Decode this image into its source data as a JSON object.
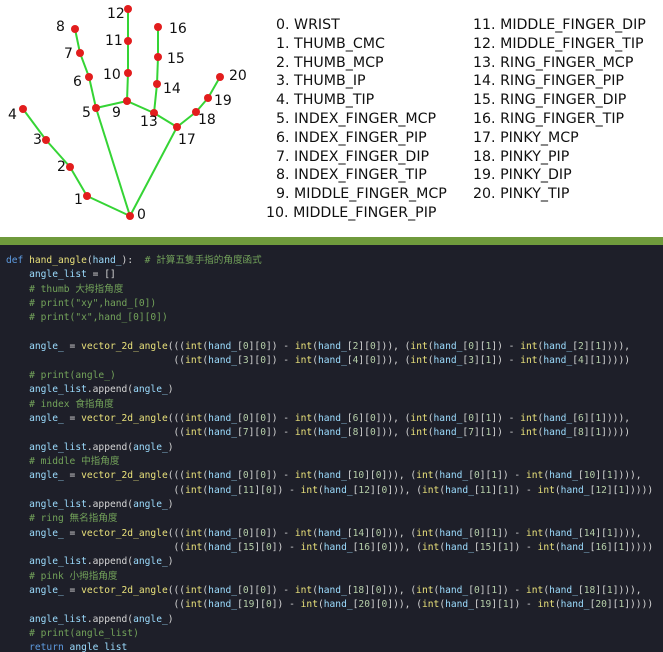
{
  "landmarks": {
    "numbers": [
      "0",
      "1",
      "2",
      "3",
      "4",
      "5",
      "6",
      "7",
      "8",
      "9",
      "10",
      "11",
      "12",
      "13",
      "14",
      "15",
      "16",
      "17",
      "18",
      "19",
      "20"
    ],
    "names": [
      "0. WRIST",
      "1. THUMB_CMC",
      "2. THUMB_MCP",
      "3. THUMB_IP",
      "4. THUMB_TIP",
      "5. INDEX_FINGER_MCP",
      "6. INDEX_FINGER_PIP",
      "7. INDEX_FINGER_DIP",
      "8. INDEX_FINGER_TIP",
      "9. MIDDLE_FINGER_MCP",
      "10. MIDDLE_FINGER_PIP",
      "11. MIDDLE_FINGER_DIP",
      "12. MIDDLE_FINGER_TIP",
      "13. RING_FINGER_MCP",
      "14. RING_FINGER_PIP",
      "15. RING_FINGER_DIP",
      "16. RING_FINGER_TIP",
      "17. PINKY_MCP",
      "18. PINKY_PIP",
      "19. PINKY_DIP",
      "20. PINKY_TIP"
    ]
  },
  "colors": {
    "point": "#e21d1d",
    "bone": "#35d435",
    "divider": "#6f9a3c",
    "code_bg": "#1e1f29"
  },
  "code": {
    "lines": [
      "def hand_angle(hand_):  # 計算五隻手指的角度函式",
      "    angle_list = []",
      "    # thumb 大拇指角度",
      "    # print(\"xy\",hand_[0])",
      "    # print(\"x\",hand_[0][0])",
      "",
      "    angle_ = vector_2d_angle(((int(hand_[0][0]) - int(hand_[2][0])), (int(hand_[0][1]) - int(hand_[2][1]))),",
      "                             ((int(hand_[3][0]) - int(hand_[4][0])), (int(hand_[3][1]) - int(hand_[4][1]))))",
      "    # print(angle_)",
      "    angle_list.append(angle_)",
      "    # index 食指角度",
      "    angle_ = vector_2d_angle(((int(hand_[0][0]) - int(hand_[6][0])), (int(hand_[0][1]) - int(hand_[6][1]))),",
      "                             ((int(hand_[7][0]) - int(hand_[8][0])), (int(hand_[7][1]) - int(hand_[8][1]))))",
      "    angle_list.append(angle_)",
      "    # middle 中指角度",
      "    angle_ = vector_2d_angle(((int(hand_[0][0]) - int(hand_[10][0])), (int(hand_[0][1]) - int(hand_[10][1]))),",
      "                             ((int(hand_[11][0]) - int(hand_[12][0])), (int(hand_[11][1]) - int(hand_[12][1]))))",
      "    angle_list.append(angle_)",
      "    # ring 無名指角度",
      "    angle_ = vector_2d_angle(((int(hand_[0][0]) - int(hand_[14][0])), (int(hand_[0][1]) - int(hand_[14][1]))),",
      "                             ((int(hand_[15][0]) - int(hand_[16][0])), (int(hand_[15][1]) - int(hand_[16][1]))))",
      "    angle_list.append(angle_)",
      "    # pink 小拇指角度",
      "    angle_ = vector_2d_angle(((int(hand_[0][0]) - int(hand_[18][0])), (int(hand_[0][1]) - int(hand_[18][1]))),",
      "                             ((int(hand_[19][0]) - int(hand_[20][0])), (int(hand_[19][1]) - int(hand_[20][1]))))",
      "    angle_list.append(angle_)",
      "    # print(angle_list)",
      "    return angle_list"
    ]
  }
}
